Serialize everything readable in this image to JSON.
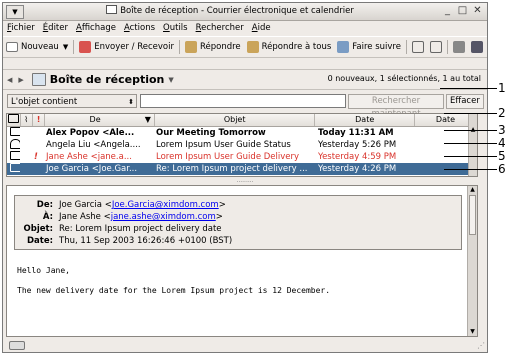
{
  "window": {
    "title": "Boîte de réception - Courrier électronique et calendrier",
    "buttons": [
      "_",
      "□",
      "✕"
    ]
  },
  "menu": {
    "items": [
      {
        "u": "F",
        "rest": "ichier"
      },
      {
        "u": "É",
        "rest": "diter"
      },
      {
        "u": "A",
        "rest": "ffichage"
      },
      {
        "u": "A",
        "rest": "ctions"
      },
      {
        "u": "O",
        "rest": "utils"
      },
      {
        "u": "R",
        "rest": "echercher"
      },
      {
        "u": "A",
        "rest": "ide"
      }
    ]
  },
  "toolbar": {
    "new": "Nouveau",
    "send_receive": "Envoyer / Recevoir",
    "reply": "Répondre",
    "reply_all": "Répondre à tous",
    "forward": "Faire suivre"
  },
  "folder": {
    "name": "Boîte de réception",
    "stats": "0 nouveaux, 1 sélectionnés, 1 au total"
  },
  "search": {
    "scope": "L'objet contient",
    "search_now": "Rechercher maintenant",
    "clear": "Effacer"
  },
  "columns": {
    "from": "De",
    "subject": "Objet",
    "date": "Date",
    "date2": "Date",
    "priority": "!"
  },
  "messages": [
    {
      "from": "Alex Popov <Ale...",
      "subject": "Our Meeting Tomorrow",
      "date": "Today 11:31 AM",
      "priority": "",
      "style": "bold"
    },
    {
      "from": "Angela Liu <Angela....",
      "subject": "Lorem Ipsum User Guide Status",
      "date": "Yesterday 5:26 PM",
      "priority": "",
      "style": ""
    },
    {
      "from": "Jane Ashe <jane.a...",
      "subject": "Lorem Ipsum User Guide Delivery",
      "date": "Yesterday 4:59 PM",
      "priority": "!",
      "style": "red"
    },
    {
      "from": "Joe Garcia <Joe.Gar...",
      "subject": "Re: Lorem Ipsum project delivery ...",
      "date": "Yesterday 4:26 PM",
      "priority": "",
      "style": "selected"
    }
  ],
  "preview": {
    "from_label": "De:",
    "from_name": "Joe Garcia <",
    "from_email": "Joe.Garcia@ximdom.com",
    "from_end": ">",
    "to_label": "À:",
    "to_name": "Jane Ashe <",
    "to_email": "jane.ashe@ximdom.com",
    "to_end": ">",
    "subject_label": "Objet:",
    "subject": "Re: Lorem Ipsum project delivery date",
    "date_label": "Date:",
    "date": "Thu, 11 Sep 2003 16:26:46 +0100 (BST)",
    "body_line1": "Hello Jane,",
    "body_line2": "The new delivery date for the Lorem Ipsum project is 12 December."
  },
  "callouts": [
    "1",
    "2",
    "3",
    "4",
    "5",
    "6"
  ],
  "colors": {
    "selected_row": "#3f6b96",
    "red_row": "#d9322a",
    "link": "#0000ee"
  }
}
